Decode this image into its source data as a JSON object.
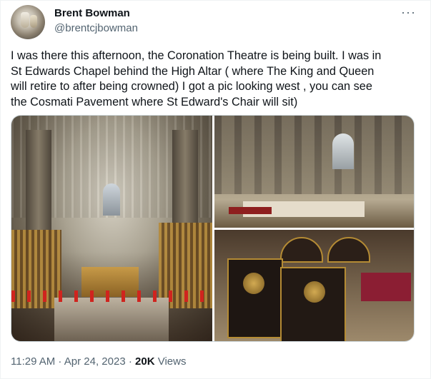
{
  "tweet": {
    "author": {
      "display_name": "Brent Bowman",
      "handle": "@brentcjbowman"
    },
    "more_label": "···",
    "text": "I was there this afternoon, the Coronation Theatre is being built. I was in\nSt Edwards Chapel behind the High Altar ( where The King and Queen\nwill retire to after being crowned) I got a pic looking west , you can see\nthe Cosmati Pavement where St Edward's Chair will sit)",
    "meta": {
      "time": "11:29 AM",
      "separator": " · ",
      "date": "Apr 24, 2023",
      "views_count": "20K",
      "views_label": " Views"
    }
  }
}
